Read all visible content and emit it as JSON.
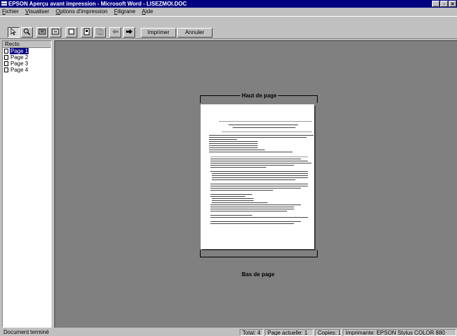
{
  "window": {
    "title": "EPSON Aperçu avant impression - Microsoft Word - LISEZMOI.DOC",
    "buttons": [
      "_",
      "▫",
      "✕"
    ]
  },
  "menu": [
    {
      "underline": "F",
      "rest": "ichier"
    },
    {
      "underline": "V",
      "rest": "isualiser"
    },
    {
      "underline": "O",
      "rest": "ptions d'impression"
    },
    {
      "underline": "F",
      "rest": "iligrane"
    },
    {
      "underline": "A",
      "rest": "ide"
    }
  ],
  "toolbar": {
    "print_label": "Imprimer",
    "cancel_label": "Annuler",
    "icons": [
      "arrow-pointer-icon",
      "zoom-icon",
      "fit-page-icon",
      "full-view-icon",
      "page-single-icon",
      "page-layout-icon",
      "multi-page-icon",
      "prev-page-icon",
      "next-page-icon"
    ]
  },
  "side_panel": {
    "header": "Recto",
    "pages": [
      "Page 1",
      "Page 2",
      "Page 3",
      "Page 4"
    ],
    "selected": 0
  },
  "preview": {
    "top_margin_label": "Haut de page",
    "bottom_margin_label": "Bas de page"
  },
  "status": {
    "message": "Document terminé",
    "total": "Total: 4",
    "current_page": "Page actuelle: 1",
    "copies": "Copies: 1",
    "printer": "Imprimante: EPSON Stylus COLOR 880"
  }
}
